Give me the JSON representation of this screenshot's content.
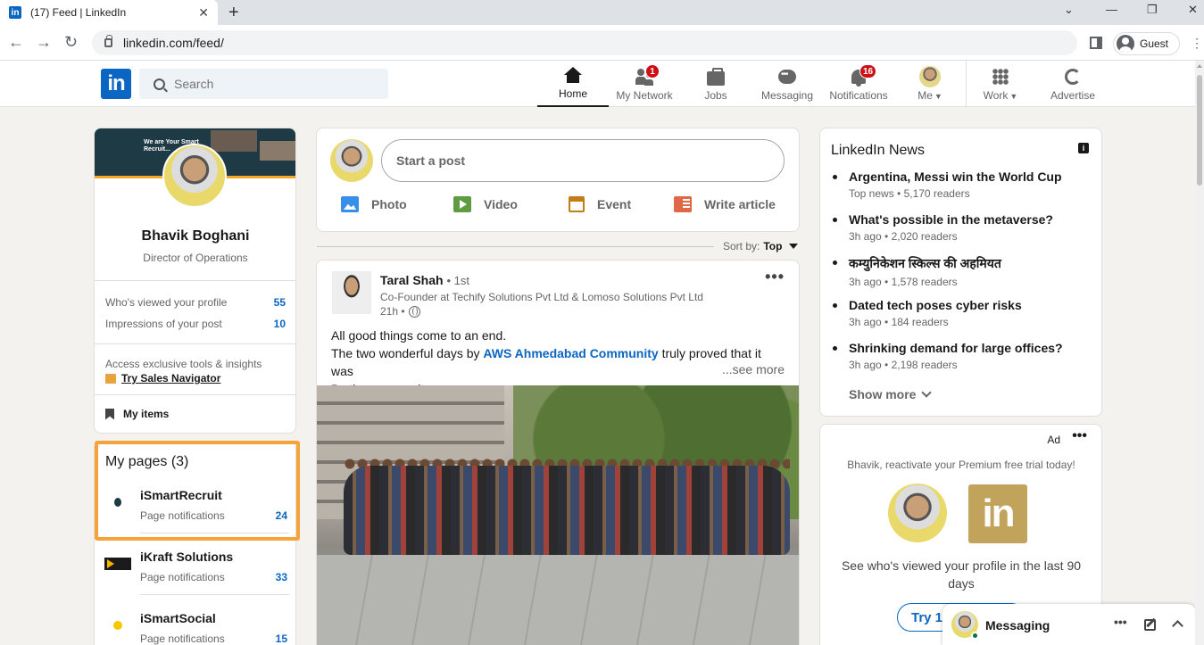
{
  "browser": {
    "tab_title": "(17) Feed | LinkedIn",
    "tab_close": "✕",
    "new_tab": "+",
    "url": "linkedin.com/feed/",
    "profile_label": "Guest",
    "back": "←",
    "forward": "→",
    "reload": "↻",
    "minimize": "—",
    "restore": "❐",
    "close": "✕",
    "menu": "⌄",
    "more": "⋮"
  },
  "header": {
    "logo_text": "in",
    "search_placeholder": "Search",
    "nav": {
      "home": "Home",
      "network": "My Network",
      "network_badge": "1",
      "jobs": "Jobs",
      "messaging": "Messaging",
      "notifications": "Notifications",
      "notifications_badge": "16",
      "me": "Me",
      "work": "Work",
      "advertise": "Advertise"
    },
    "caret": "▼"
  },
  "profile": {
    "cover_text": "We are Your Smart Recruit...",
    "name": "Bhavik Boghani",
    "title": "Director of Operations",
    "stats": [
      {
        "label": "Who's viewed your profile",
        "value": "55"
      },
      {
        "label": "Impressions of your post",
        "value": "10"
      }
    ],
    "promo_text": "Access exclusive tools & insights",
    "promo_link": "Try Sales Navigator",
    "my_items": "My items"
  },
  "pages": {
    "title": "My pages (3)",
    "items": [
      {
        "name": "iSmartRecruit",
        "sub": "Page notifications",
        "count": "24"
      },
      {
        "name": "iKraft Solutions",
        "sub": "Page notifications",
        "count": "33"
      },
      {
        "name": "iSmartSocial",
        "sub": "Page notifications",
        "count": "15"
      }
    ]
  },
  "composer": {
    "start_post": "Start a post",
    "photo": "Photo",
    "video": "Video",
    "event": "Event",
    "article": "Write article"
  },
  "sort": {
    "label": "Sort by:",
    "value": "Top"
  },
  "post": {
    "author": "Taral Shah",
    "degree": "• 1st",
    "headline": "Co-Founder at Techify Solutions Pvt Ltd & Lomoso Solutions Pvt Ltd",
    "time": "21h •",
    "more": "•••",
    "line1": "All good things come to an end.",
    "line2_prefix": "The two wonderful days by ",
    "line2_link": "AWS Ahmedabad Community",
    "line2_suffix": " truly proved that it was",
    "line3": "By the community",
    "see_more": "...see more"
  },
  "news": {
    "title": "LinkedIn News",
    "info": "i",
    "items": [
      {
        "headline": "Argentina, Messi win the World Cup",
        "meta": "Top news • 5,170 readers"
      },
      {
        "headline": "What's possible in the metaverse?",
        "meta": "3h ago • 2,020 readers"
      },
      {
        "headline": "कम्युनिकेशन स्किल्स की अहमियत",
        "meta": "3h ago • 1,578 readers"
      },
      {
        "headline": "Dated tech poses cyber risks",
        "meta": "3h ago • 184 readers"
      },
      {
        "headline": "Shrinking demand for large offices?",
        "meta": "3h ago • 2,198 readers"
      }
    ],
    "show_more": "Show more"
  },
  "ad": {
    "label": "Ad",
    "more": "•••",
    "tagline": "Bhavik, reactivate your Premium free trial today!",
    "logo_text": "in",
    "text": "See who's viewed your profile in the last 90 days",
    "button": "Try 1"
  },
  "messaging": {
    "label": "Messaging",
    "more": "•••"
  }
}
